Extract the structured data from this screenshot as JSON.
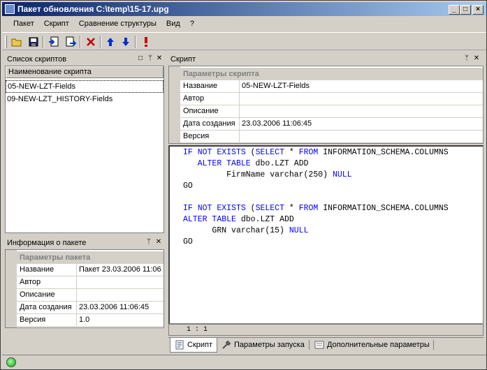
{
  "window": {
    "title": "Пакет обновления C:\\temp\\15-17.upg"
  },
  "menu": [
    "Пакет",
    "Скрипт",
    "Сравнение структуры",
    "Вид",
    "?"
  ],
  "toolbar": {
    "icons": [
      "open-folder-icon",
      "save-icon",
      "import-icon",
      "export-icon",
      "delete-icon",
      "move-up-icon",
      "move-down-icon",
      "execute-icon"
    ]
  },
  "scripts_panel": {
    "title": "Список скриптов",
    "column": "Наименование скрипта",
    "items": [
      "05-NEW-LZT-Fields",
      "09-NEW-LZT_HISTORY-Fields"
    ]
  },
  "package_panel": {
    "title": "Информация о пакете",
    "group": "Параметры пакета",
    "rows": [
      {
        "name": "Название",
        "value": "Пакет 23.03.2006 11:06"
      },
      {
        "name": "Автор",
        "value": ""
      },
      {
        "name": "Описание",
        "value": ""
      },
      {
        "name": "Дата создания",
        "value": "23.03.2006 11:06:45"
      },
      {
        "name": "Версия",
        "value": "1.0"
      }
    ]
  },
  "script_panel": {
    "title": "Скрипт",
    "group": "Параметры скрипта",
    "rows": [
      {
        "name": "Название",
        "value": "05-NEW-LZT-Fields"
      },
      {
        "name": "Автор",
        "value": ""
      },
      {
        "name": "Описание",
        "value": ""
      },
      {
        "name": "Дата создания",
        "value": "23.03.2006 11:06:45"
      },
      {
        "name": "Версия",
        "value": ""
      }
    ]
  },
  "editor": {
    "lines": [
      "IF NOT EXISTS (SELECT * FROM INFORMATION_SCHEMA.COLUMNS",
      "   ALTER TABLE dbo.LZT ADD",
      "         FirmName varchar(250) NULL",
      "GO",
      "",
      "IF NOT EXISTS (SELECT * FROM INFORMATION_SCHEMA.COLUMNS",
      "ALTER TABLE dbo.LZT ADD",
      "      GRN varchar(15) NULL",
      "GO"
    ],
    "position": "1 : 1"
  },
  "tabs": [
    "Скрипт",
    "Параметры запуска",
    "Дополнительные параметры"
  ],
  "colors": {
    "title_start": "#0a246a",
    "title_end": "#a6caf0",
    "keyword": "#0000ff",
    "face": "#d4d0c8"
  }
}
